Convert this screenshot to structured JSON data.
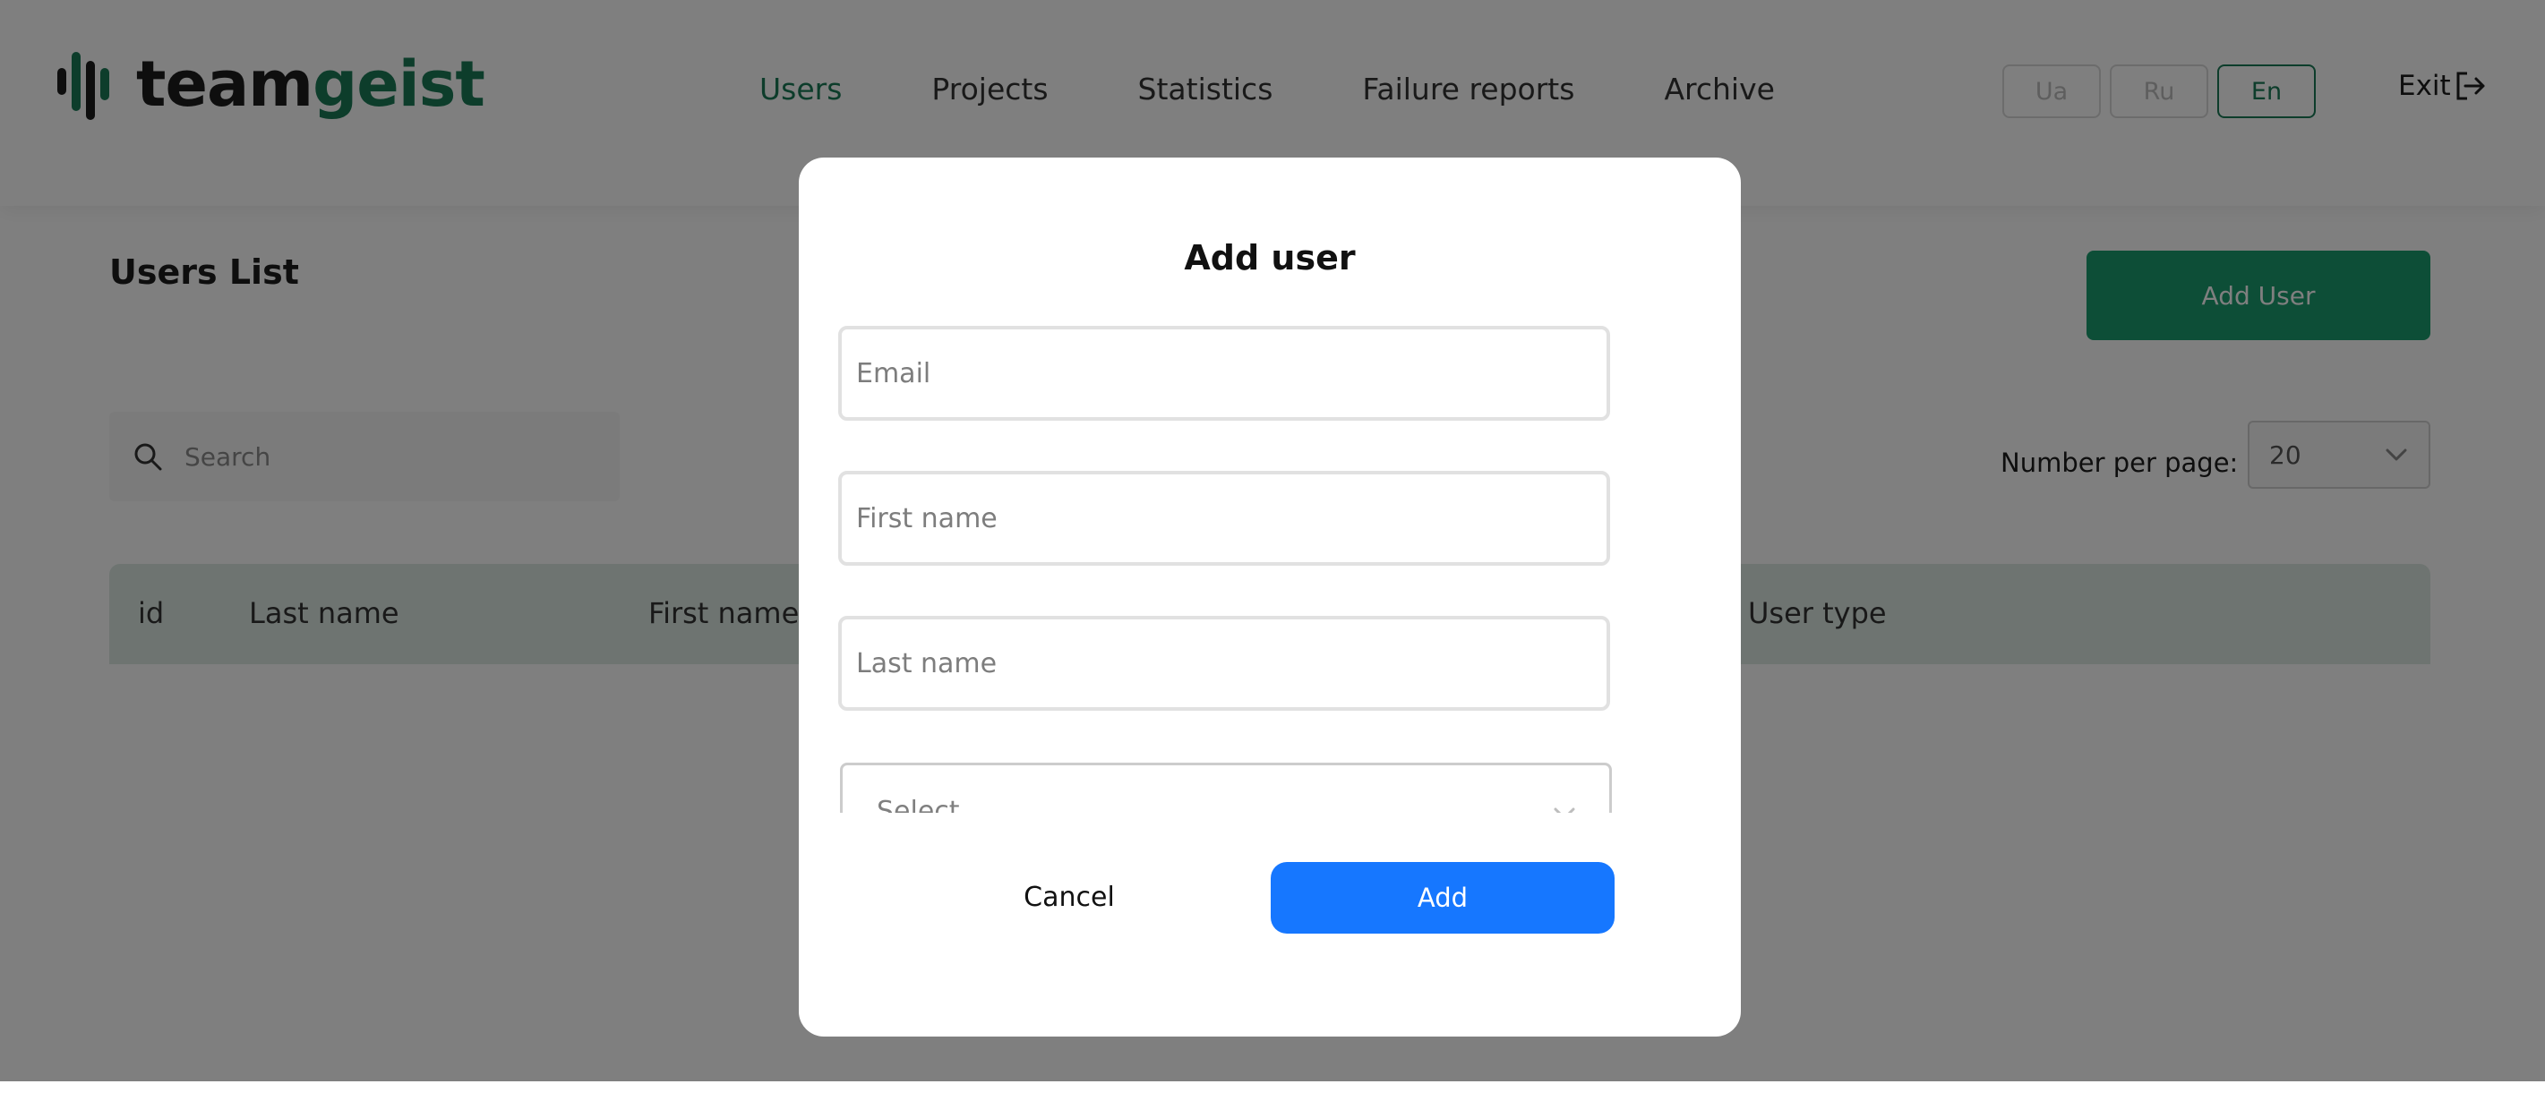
{
  "header": {
    "logo": {
      "part1": "team",
      "part2": "geist"
    },
    "nav": [
      {
        "label": "Users",
        "active": true
      },
      {
        "label": "Projects",
        "active": false
      },
      {
        "label": "Statistics",
        "active": false
      },
      {
        "label": "Failure reports",
        "active": false
      },
      {
        "label": "Archive",
        "active": false
      }
    ],
    "languages": [
      {
        "label": "Ua",
        "active": false
      },
      {
        "label": "Ru",
        "active": false
      },
      {
        "label": "En",
        "active": true
      }
    ],
    "exit_label": "Exit"
  },
  "page": {
    "title": "Users List",
    "add_user_label": "Add User",
    "search_placeholder": "Search",
    "per_page_label": "Number per page:",
    "per_page_value": "20",
    "table_columns": [
      "id",
      "Last name",
      "First name",
      "User type"
    ]
  },
  "modal": {
    "title": "Add user",
    "email_placeholder": "Email",
    "first_name_placeholder": "First name",
    "last_name_placeholder": "Last name",
    "select_placeholder": "Select...",
    "cancel_label": "Cancel",
    "add_label": "Add"
  },
  "colors": {
    "brand_green": "#1a7a57",
    "add_user_green": "#1a9c6e",
    "primary_blue": "#1677ff",
    "table_header": "#dce9e3",
    "overlay": "rgba(0,0,0,0.5)"
  },
  "icons": {
    "logo": "equalizer-bars-icon",
    "exit": "logout-arrow-icon",
    "search": "search-icon",
    "dropdown": "chevron-down-icon"
  }
}
